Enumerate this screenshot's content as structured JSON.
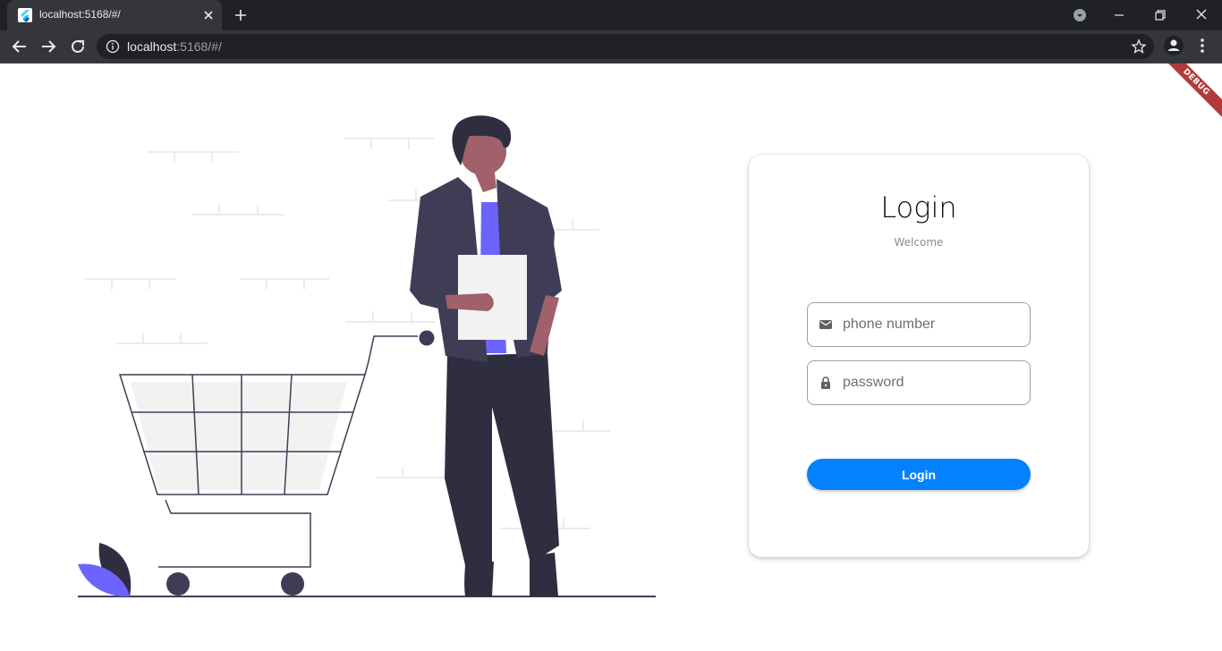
{
  "browser": {
    "tab_title": "localhost:5168/#/",
    "url_host": "localhost",
    "url_path": ":5168/#/"
  },
  "debug_banner": "DEBUG",
  "login_card": {
    "title": "Login",
    "subtitle": "Welcome",
    "phone_placeholder": "phone number",
    "password_placeholder": "password",
    "button_label": "Login",
    "accent_color": "#0381ff"
  },
  "illustration": {
    "subject": "person-with-shopping-cart",
    "colors": {
      "dark": "#3f3d56",
      "pants": "#2f2e41",
      "skin": "#a0616a",
      "accent": "#6c63ff",
      "basket": "#f2f2f2"
    }
  }
}
